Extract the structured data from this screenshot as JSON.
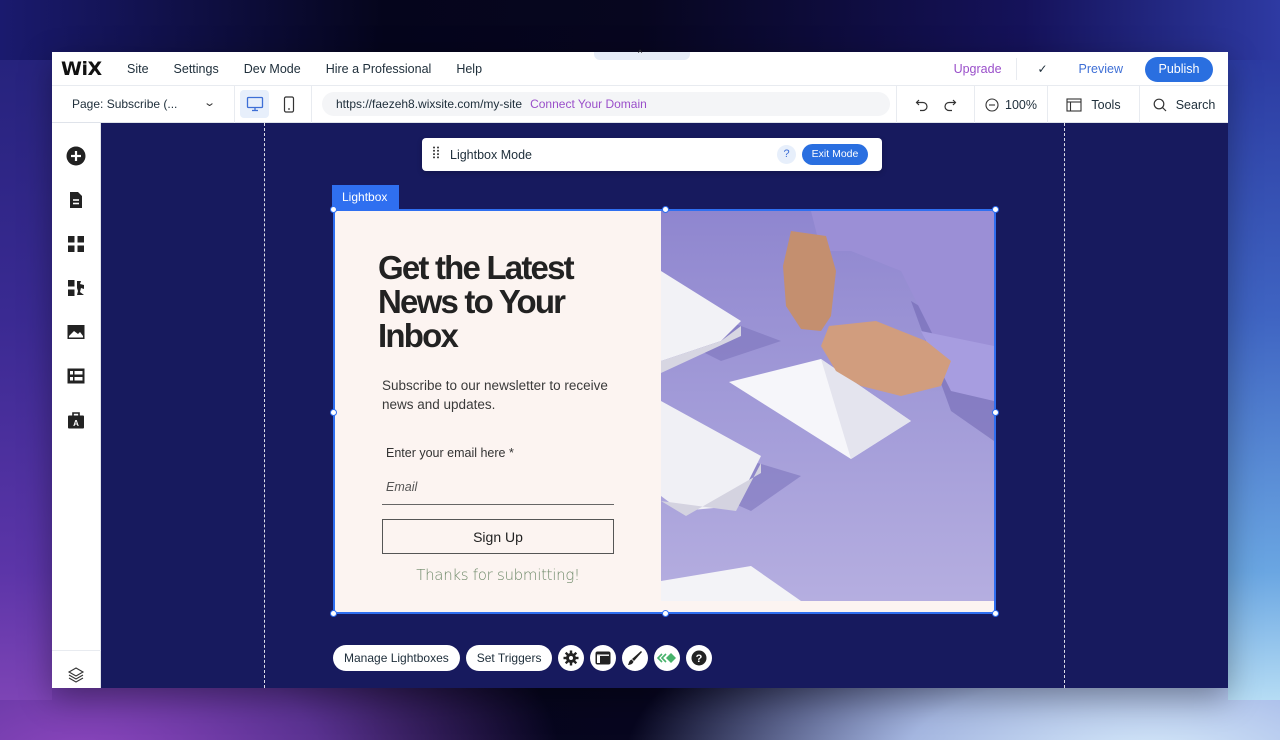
{
  "app": {
    "logo": "WiX",
    "menu": [
      "Site",
      "Settings",
      "Dev Mode",
      "Hire a Professional",
      "Help"
    ],
    "collapse_glyph": "^",
    "upgrade": "Upgrade",
    "check_glyph": "✓",
    "preview": "Preview",
    "publish": "Publish"
  },
  "toolbar": {
    "page_select": "Page: Subscribe (...",
    "url": "https://faezeh8.wixsite.com/my-site",
    "connect_domain": "Connect Your Domain",
    "zoom": "100%",
    "tools": "Tools",
    "search": "Search"
  },
  "sidebar": {
    "items": [
      "add-elements",
      "pages",
      "design",
      "apps",
      "media",
      "cms",
      "business"
    ],
    "bottom": "layers"
  },
  "lightbox_mode": {
    "title": "Lightbox Mode",
    "help": "?",
    "exit": "Exit Mode"
  },
  "lightbox": {
    "tag": "Lightbox",
    "headline": "Get the Latest News to Your Inbox",
    "subcopy": "Subscribe to our newsletter to receive news and updates.",
    "email_label": "Enter your email here *",
    "email_placeholder": "Email",
    "email_value": "",
    "signup": "Sign Up",
    "thanks": "Thanks for submitting!"
  },
  "bottom_tools": {
    "manage": "Manage Lightboxes",
    "triggers": "Set Triggers",
    "icons": [
      "settings",
      "layout",
      "design-brush",
      "animation",
      "help"
    ]
  },
  "colors": {
    "accent": "#2a6fe0",
    "upgrade": "#9a4fca",
    "canvas": "#171a5e",
    "lightbox_bg": "#fcf4f1",
    "thanks": "#6f8a6a"
  }
}
